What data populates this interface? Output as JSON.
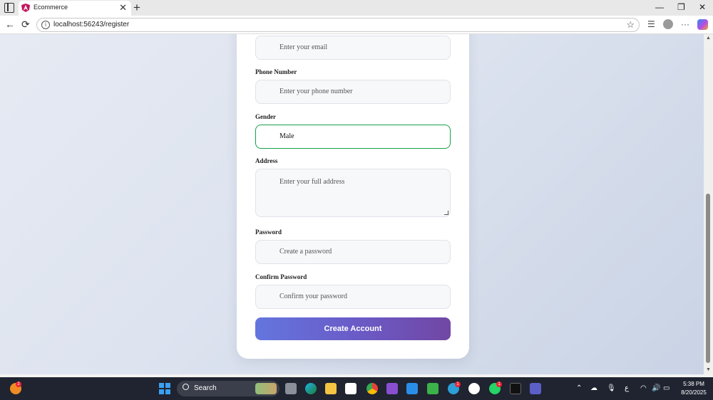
{
  "browser": {
    "tab_title": "Ecommerce",
    "tab_close": "✕",
    "new_tab": "+",
    "url": "localhost:56243/register",
    "window_controls": {
      "minimize": "—",
      "restore": "❐",
      "close": "✕"
    },
    "nav": {
      "back": "←",
      "reload": "⟳"
    },
    "toolbar_icons": {
      "favorites": "☆",
      "collections": "☰",
      "more": "···"
    }
  },
  "form": {
    "email": {
      "placeholder": "Enter your email"
    },
    "phone": {
      "label": "Phone Number",
      "placeholder": "Enter your phone number"
    },
    "gender": {
      "label": "Gender",
      "value": "Male"
    },
    "address": {
      "label": "Address",
      "placeholder": "Enter your full address"
    },
    "password": {
      "label": "Password",
      "placeholder": "Create a password"
    },
    "confirm_password": {
      "label": "Confirm Password",
      "placeholder": "Confirm your password"
    },
    "submit_label": "Create Account"
  },
  "taskbar": {
    "search_label": "Search",
    "time": "5:38 PM",
    "date": "8/20/2025",
    "notification_badge": "2",
    "app_badge": "1",
    "whatsapp_badge": "1",
    "lang": "ع"
  },
  "colors": {
    "accent_green": "#1aa04a",
    "button_gradient_start": "#6476de",
    "button_gradient_end": "#7147a4"
  }
}
